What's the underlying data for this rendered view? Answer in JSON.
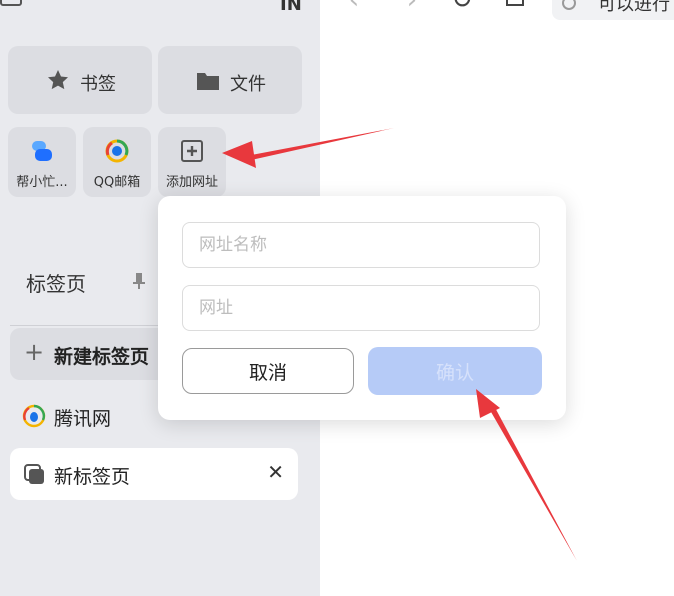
{
  "topbar": {
    "sidebar_right_glyph": "IN",
    "address_text": "可以进行"
  },
  "tiles": {
    "bookmark_label": "书签",
    "file_label": "文件"
  },
  "quick_links": [
    {
      "label": "帮小忙..."
    },
    {
      "label": "QQ邮箱"
    },
    {
      "label": "添加网址"
    }
  ],
  "tabs": {
    "title": "标签页",
    "new_tab_label": "新建标签页",
    "items": [
      {
        "label": "腾讯网"
      },
      {
        "label": "新标签页"
      }
    ]
  },
  "dialog": {
    "name_placeholder": "网址名称",
    "url_placeholder": "网址",
    "cancel_label": "取消",
    "confirm_label": "确认"
  },
  "colors": {
    "sidebar_bg": "#e9eaee",
    "tile_bg": "#dcdde2",
    "confirm_button": "#b6cbf7",
    "annotation_arrow": "#e8383d"
  },
  "icons": [
    "star-icon",
    "folder-icon",
    "bangxiaomang-icon",
    "qq-mail-icon",
    "add-site-icon",
    "pin-icon",
    "plus-icon",
    "tencent-icon",
    "tab-icon",
    "close-icon"
  ]
}
